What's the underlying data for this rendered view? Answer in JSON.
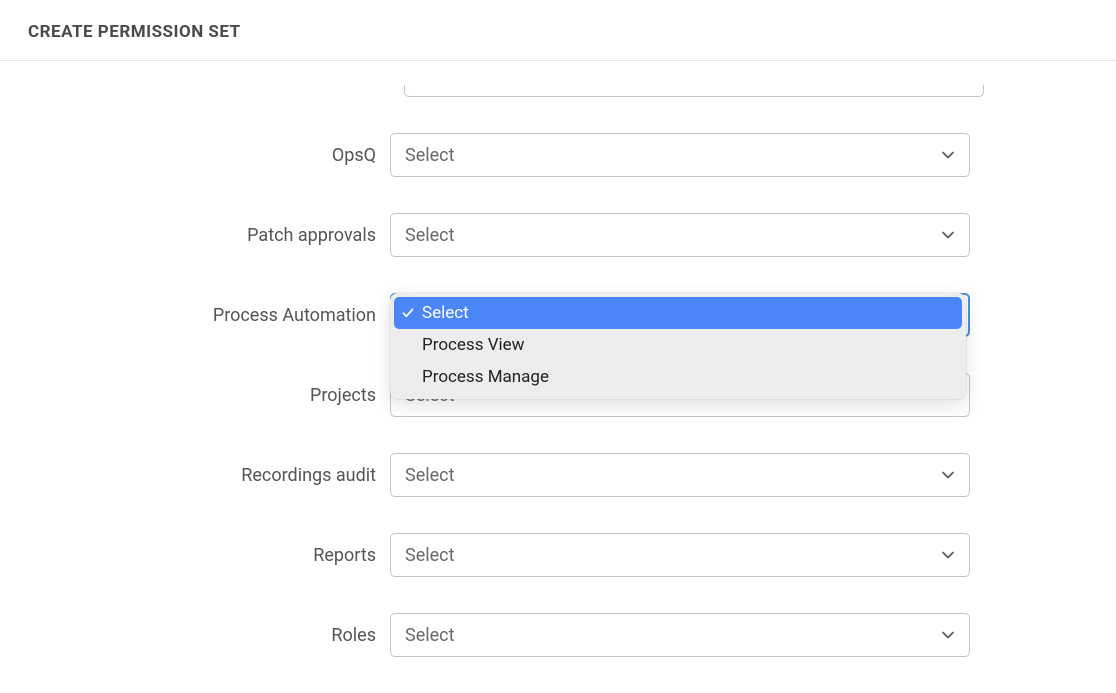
{
  "header": {
    "title": "CREATE PERMISSION SET"
  },
  "placeholder": "Select",
  "rows": {
    "opsq": {
      "label": "OpsQ"
    },
    "patch_approvals": {
      "label": "Patch approvals"
    },
    "process_automation": {
      "label": "Process Automation",
      "options": {
        "o0": "Select",
        "o1": "Process View",
        "o2": "Process Manage"
      }
    },
    "projects": {
      "label": "Projects"
    },
    "recordings_audit": {
      "label": "Recordings audit"
    },
    "reports": {
      "label": "Reports"
    },
    "roles": {
      "label": "Roles"
    }
  }
}
